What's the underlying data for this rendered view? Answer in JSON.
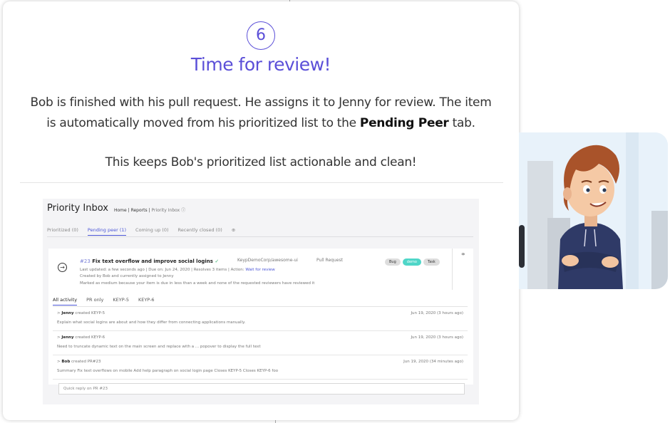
{
  "step": {
    "number": "6",
    "title": "Time for review!",
    "desc_before": "Bob is finished with his pull request. He assigns it to Jenny for review. The item is automatically moved from his prioritized list to the ",
    "desc_bold": "Pending Peer",
    "desc_after": " tab.",
    "desc2": "This keeps Bob's prioritized list actionable and clean!"
  },
  "inbox": {
    "title": "Priority Inbox",
    "crumbs": [
      "Home",
      "|",
      "Reports",
      "|",
      "Priority Inbox"
    ],
    "help_icon": "help-circle-icon",
    "tabs": [
      "Prioritized (0)",
      "Pending peer (1)",
      "Coming up (0)",
      "Recently closed (0)"
    ],
    "add_tab_icon": "plus-circle-icon",
    "item": {
      "number": "#23",
      "title": "Fix text overflow and improve social logins",
      "repo": "KeypDemoCorp/awesome-ui",
      "kind": "Pull Request",
      "updated": "Last updated: a few seconds ago",
      "due": "Due on: Jun 24, 2020",
      "resolves": "Resolves 3 items",
      "action_label": "Action:",
      "action": "Wait for review",
      "created": "Created by Bob and currently assigned to Jenny",
      "reason": "Marked as medium because your item is due in less than a week and none of the requested reviewers have reviewed it",
      "badges": [
        "Bug",
        "demo",
        "Task"
      ]
    },
    "activity_tabs": [
      "All activity",
      "PR only",
      "KEYP-5",
      "KEYP-6"
    ],
    "entries": [
      {
        "who": "Jenny",
        "verb": "created KEYP-5",
        "when": "Jun 19, 2020 (3 hours ago)",
        "body": "Explain what social logins are about and how they differ from connecting applications manually."
      },
      {
        "who": "Jenny",
        "verb": "created KEYP-6",
        "when": "Jun 19, 2020 (3 hours ago)",
        "body": "Need to truncate dynamic text on the main screen and replace with a ... popover to display the full text"
      },
      {
        "who": "Bob",
        "verb": "created PR#23",
        "when": "Jun 19, 2020 (34 minutes ago)",
        "body": "Summary Fix text overflows on mobile Add help paragraph on social login page Closes KEYP-5 Closes KEYP-6 foo"
      }
    ],
    "reply_placeholder": "Quick reply on PR #23"
  },
  "colors": {
    "accent": "#5b4fd8",
    "link": "#4a55d6",
    "demo_badge": "#4fd6c8"
  }
}
